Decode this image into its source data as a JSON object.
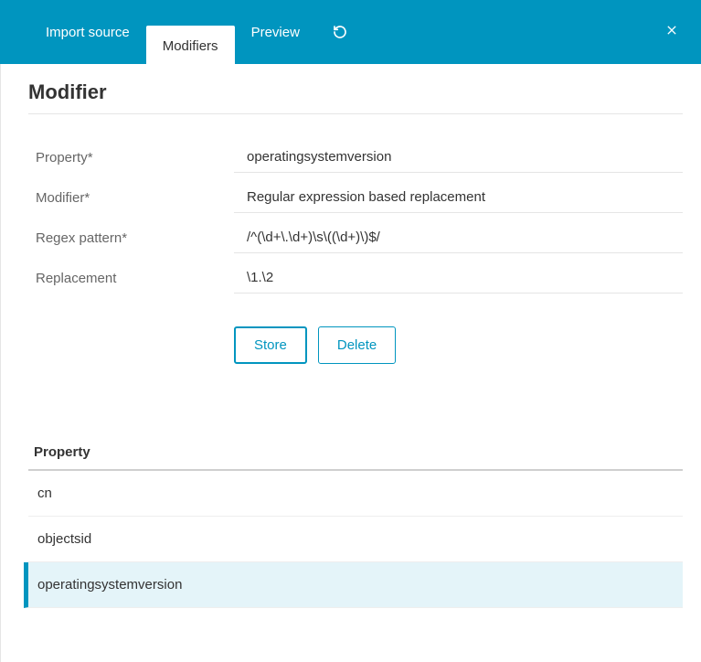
{
  "tabs": {
    "import_source": "Import source",
    "modifiers": "Modifiers",
    "preview": "Preview"
  },
  "page": {
    "title": "Modifier"
  },
  "form": {
    "labels": {
      "property": "Property*",
      "modifier": "Modifier*",
      "regex_pattern": "Regex pattern*",
      "replacement": "Replacement"
    },
    "values": {
      "property": "operatingsystemversion",
      "modifier": "Regular expression based replacement",
      "regex_pattern": "/^(\\d+\\.\\d+)\\s\\((\\d+)\\)$/",
      "replacement": "\\1.\\2"
    }
  },
  "buttons": {
    "store": "Store",
    "delete": "Delete"
  },
  "table": {
    "header": "Property",
    "rows": [
      {
        "label": "cn",
        "selected": false
      },
      {
        "label": "objectsid",
        "selected": false
      },
      {
        "label": "operatingsystemversion",
        "selected": true
      }
    ]
  }
}
